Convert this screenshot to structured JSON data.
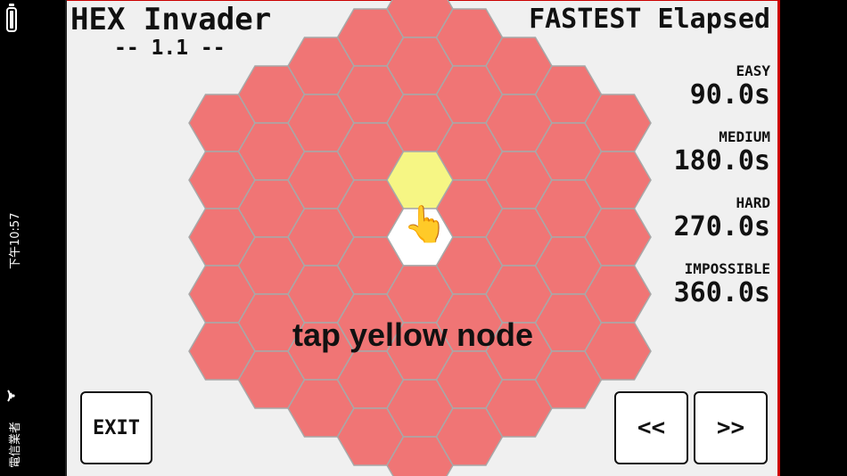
{
  "status_bar": {
    "time": "下午10:57",
    "carrier": "電信業者",
    "battery_icon": "battery-icon",
    "wifi_icon": "wifi-icon"
  },
  "game": {
    "title": "HEX Invader",
    "version": "-- 1.1 --",
    "hint": "tap yellow node",
    "hand_icon": "pointing-hand-icon",
    "colors": {
      "hex_fill": "#f07575",
      "hex_border": "#a8a8a8",
      "active_node": "#f6f684",
      "empty_node": "#ffffff",
      "background": "#f0f0f0",
      "frame": "#cc0000"
    }
  },
  "records": {
    "heading": "FASTEST Elapsed",
    "levels": [
      {
        "label": "EASY",
        "time": "90.0s"
      },
      {
        "label": "MEDIUM",
        "time": "180.0s"
      },
      {
        "label": "HARD",
        "time": "270.0s"
      },
      {
        "label": "IMPOSSIBLE",
        "time": "360.0s"
      }
    ]
  },
  "buttons": {
    "exit": "EXIT",
    "prev": "<<",
    "next": ">>"
  }
}
